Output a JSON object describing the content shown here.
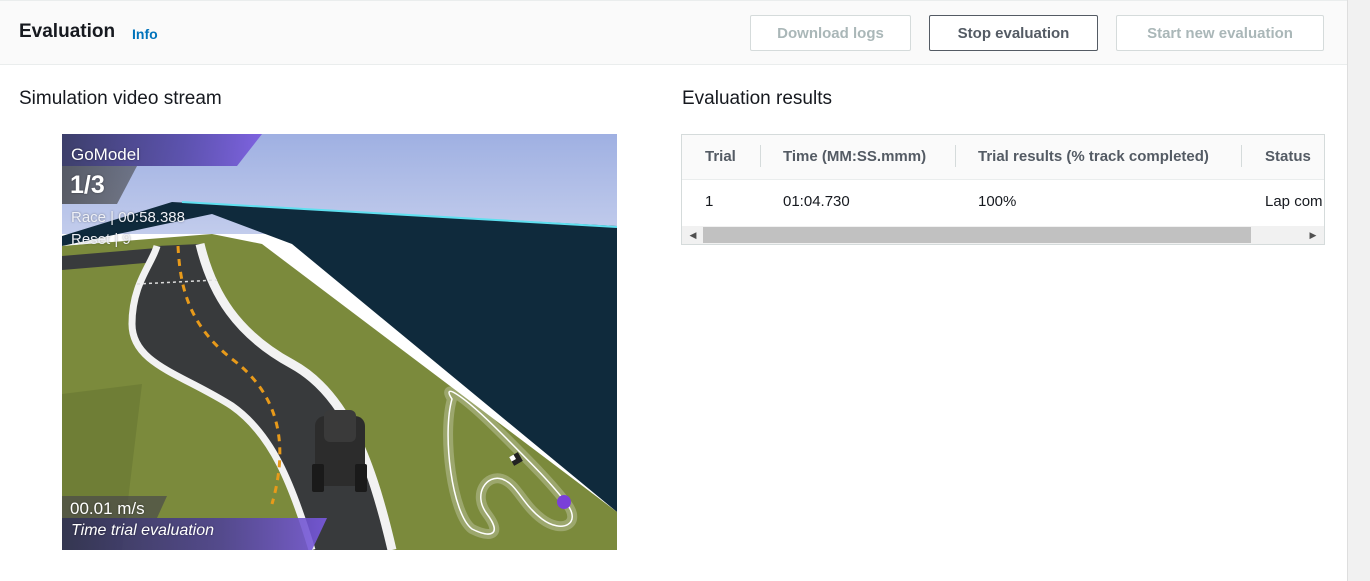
{
  "header": {
    "title": "Evaluation",
    "info_link": "Info",
    "buttons": {
      "download": "Download logs",
      "stop": "Stop evaluation",
      "start": "Start new evaluation"
    }
  },
  "simulation": {
    "title": "Simulation video stream",
    "overlay": {
      "model": "GoModel",
      "lap": "1/3",
      "race": "Race | 00:58.388",
      "reset": "Reset | 9",
      "speed": "00.01 m/s",
      "mode": "Time trial evaluation"
    }
  },
  "results": {
    "title": "Evaluation results",
    "columns": [
      "Trial",
      "Time (MM:SS.mmm)",
      "Trial results (% track completed)",
      "Status"
    ],
    "rows": [
      [
        "1",
        "01:04.730",
        "100%",
        "Lap com"
      ]
    ]
  },
  "icons": {
    "scroll_left": "scroll-left-arrow-icon",
    "scroll_right": "scroll-right-arrow-icon"
  },
  "colors": {
    "link": "#0073bb",
    "sky": "#9aa8d8",
    "wall": "#0f2a3c",
    "grass": "#7d8a3a",
    "road": "#3b3b3b",
    "center_line": "#e69a1c",
    "overlay_accent": "#6a4ad0"
  }
}
